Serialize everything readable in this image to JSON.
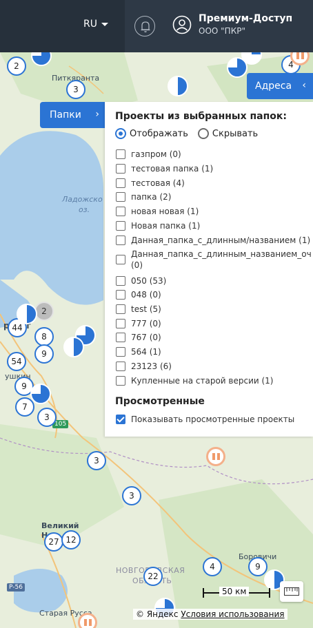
{
  "topbar": {
    "language": "RU",
    "user_title": "Премиум-Доступ",
    "user_org": "ООО \"ПКР\""
  },
  "map": {
    "labels": {
      "pitkyaranta": "Питкяранта",
      "ladoga_1": "Ладожско",
      "ladoga_2": "оз.",
      "pushkin": "ушкин",
      "spb": "рбург",
      "velikiy": "Великий",
      "novgorod": "Н",
      "novgorod_obl_1": "НОВГОРОДСКАЯ",
      "novgorod_obl_2": "ОБЛАСТЬ",
      "borovichi": "Боровичи",
      "staraya_russa": "Старая Русса"
    },
    "roads": {
      "a105": "105",
      "p56": "P-56"
    },
    "clusters": [
      "2",
      "3",
      "4",
      "2",
      "44",
      "8",
      "9",
      "54",
      "9",
      "7",
      "3",
      "3",
      "3",
      "27",
      "12",
      "22",
      "4",
      "9"
    ],
    "scale_label": "50 км",
    "attribution_prefix": "© Яндекс",
    "attribution_link": "Условия использования"
  },
  "tabs": {
    "addresses": "Адреса",
    "folders": "Папки"
  },
  "panel": {
    "title": "Проекты из выбранных папок:",
    "show_label": "Отображать",
    "hide_label": "Скрывать",
    "folders": [
      "газпром (0)",
      "тестовая папка (1)",
      "тестовая (4)",
      "папка (2)",
      "новая новая (1)",
      "Новая папка (1)",
      "Данная_папка_с_длинным/названием (1)",
      "Данная_папка_с_длинным_названием_оч",
      "(0)",
      "050 (53)",
      "048 (0)",
      "test (5)",
      "777 (0)",
      "767 (0)",
      "564 (1)",
      "23123 (6)",
      "Купленные на старой версии (1)"
    ],
    "viewed_title": "Просмотренные",
    "viewed_label": "Показывать просмотренные проекты"
  },
  "colors": {
    "accent": "#2b74d4",
    "topbar": "#26303b"
  }
}
